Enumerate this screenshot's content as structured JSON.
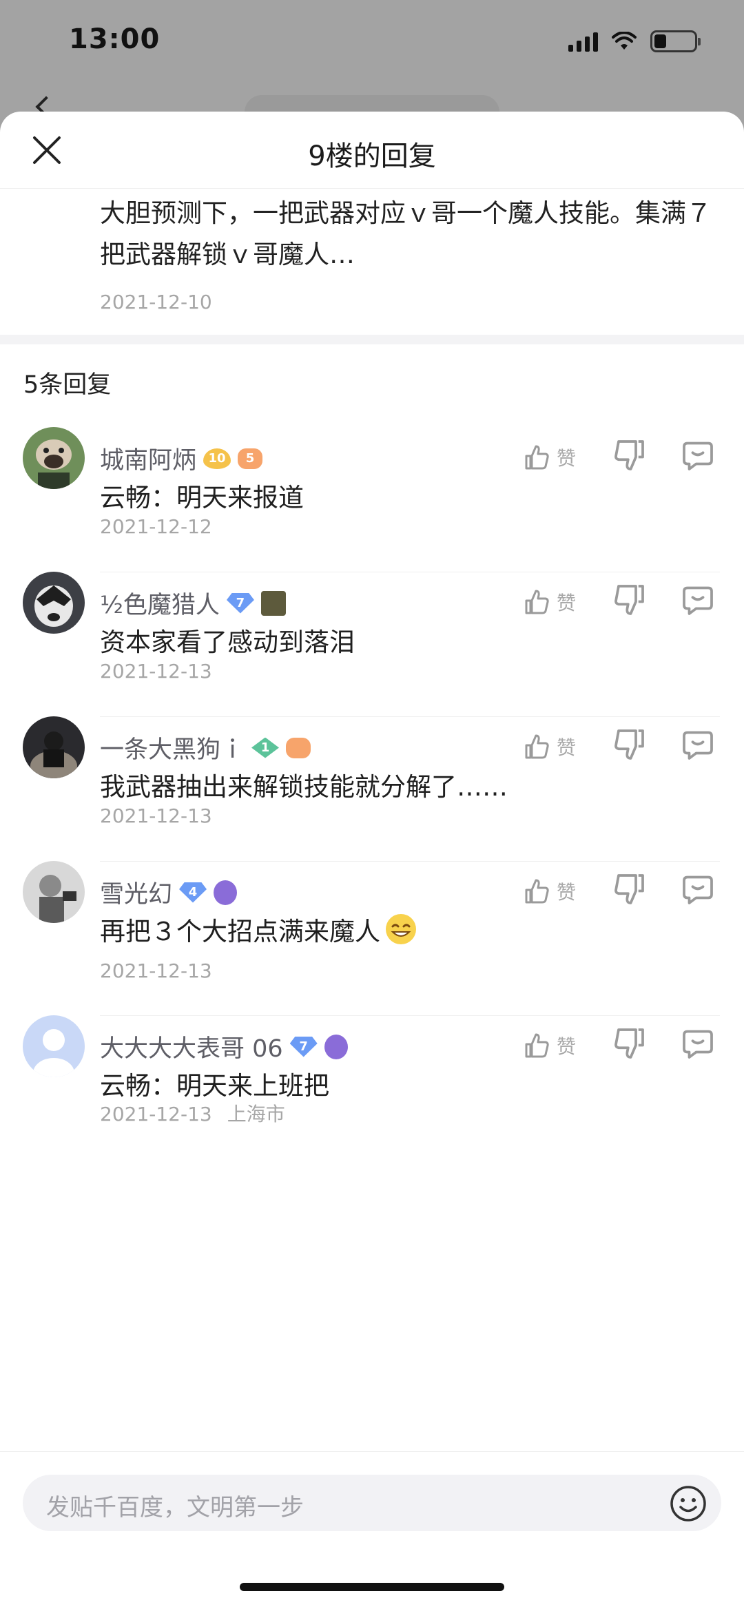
{
  "status_bar": {
    "time": "13:00"
  },
  "sheet": {
    "title": "9楼的回复"
  },
  "original_post": {
    "text": "大胆预测下，一把武器对应ｖ哥一个魔人技能。集满７把武器解锁ｖ哥魔人…",
    "date": "2021-12-10"
  },
  "reply_count_label": "5条回复",
  "like_label": "赞",
  "replies": [
    {
      "username": "城南阿炳",
      "badge_level": "10",
      "badge2": "5",
      "text": "云畅：明天来报道",
      "date": "2021-12-12",
      "location": ""
    },
    {
      "username": "½色魔猎人",
      "badge_level": "7",
      "badge2": "",
      "text": "资本家看了感动到落泪",
      "date": "2021-12-13",
      "location": ""
    },
    {
      "username": "一条大黑狗ｉ",
      "badge_level": "1",
      "badge2": "",
      "text": "我武器抽出来解锁技能就分解了……",
      "date": "2021-12-13",
      "location": ""
    },
    {
      "username": "雪光幻",
      "badge_level": "4",
      "badge2": "",
      "text": "再把３个大招点满来魔人",
      "date": "2021-12-13",
      "location": ""
    },
    {
      "username": "大大大大表哥 06",
      "badge_level": "7",
      "badge2": "",
      "text": "云畅：明天来上班把",
      "date": "2021-12-13",
      "location": "上海市"
    }
  ],
  "input": {
    "placeholder": "发贴千百度，文明第一步"
  },
  "icons": {
    "close": "close-icon",
    "thumbs_up": "thumbs-up-icon",
    "thumbs_down": "thumbs-down-icon",
    "comment": "comment-icon",
    "emoji": "emoji-icon"
  },
  "colors": {
    "muted": "#a6a6a6",
    "username": "#5e5e66",
    "text": "#1f1f1f"
  }
}
